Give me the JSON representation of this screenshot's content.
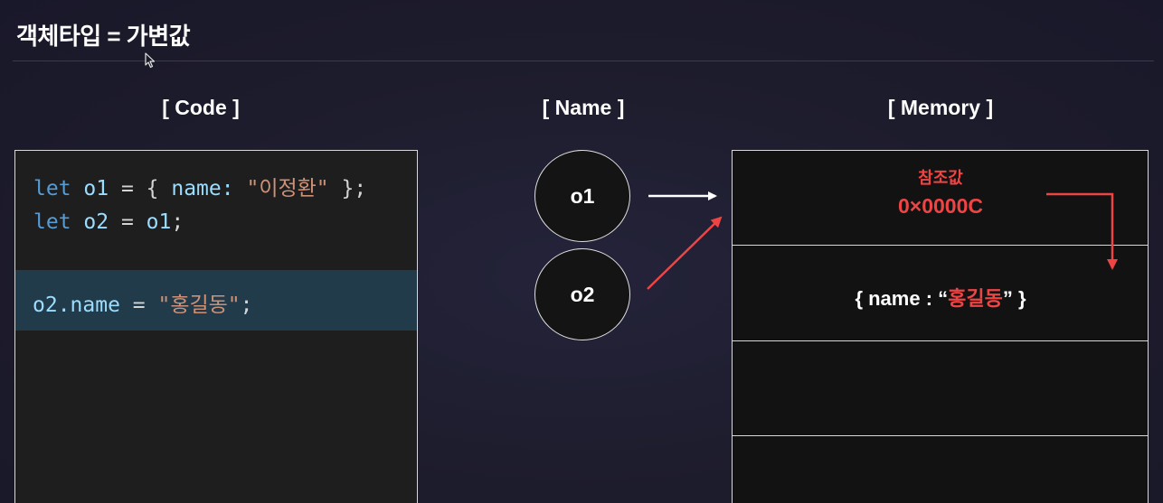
{
  "header": {
    "title": "객체타입 = 가변값"
  },
  "sections": {
    "code_label": "[ Code ]",
    "name_label": "[ Name ]",
    "memory_label": "[ Memory ]"
  },
  "code": {
    "line1": {
      "kw": "let",
      "var": "o1",
      "eq": " = { ",
      "prop": "name:",
      "str": "\"이정환\"",
      "end": " };"
    },
    "line2": {
      "kw": "let",
      "var": "o2",
      "eq": " = ",
      "ref": "o1",
      "end": ";"
    },
    "line3": {
      "var": "o2.name",
      "eq": " = ",
      "str": "\"홍길동\"",
      "end": ";"
    }
  },
  "names": {
    "o1": "o1",
    "o2": "o2"
  },
  "memory": {
    "ref_label": "참조값",
    "ref_address": "0×0000C",
    "object_prefix": "{ name : “",
    "object_value": "홍길동",
    "object_suffix": "” }"
  },
  "colors": {
    "background": "#1c1b29",
    "accent_red": "#ef4444",
    "code_keyword": "#569cd6",
    "code_variable": "#9cdcfe",
    "code_string": "#ce9178",
    "highlight_row": "#213b4b"
  }
}
